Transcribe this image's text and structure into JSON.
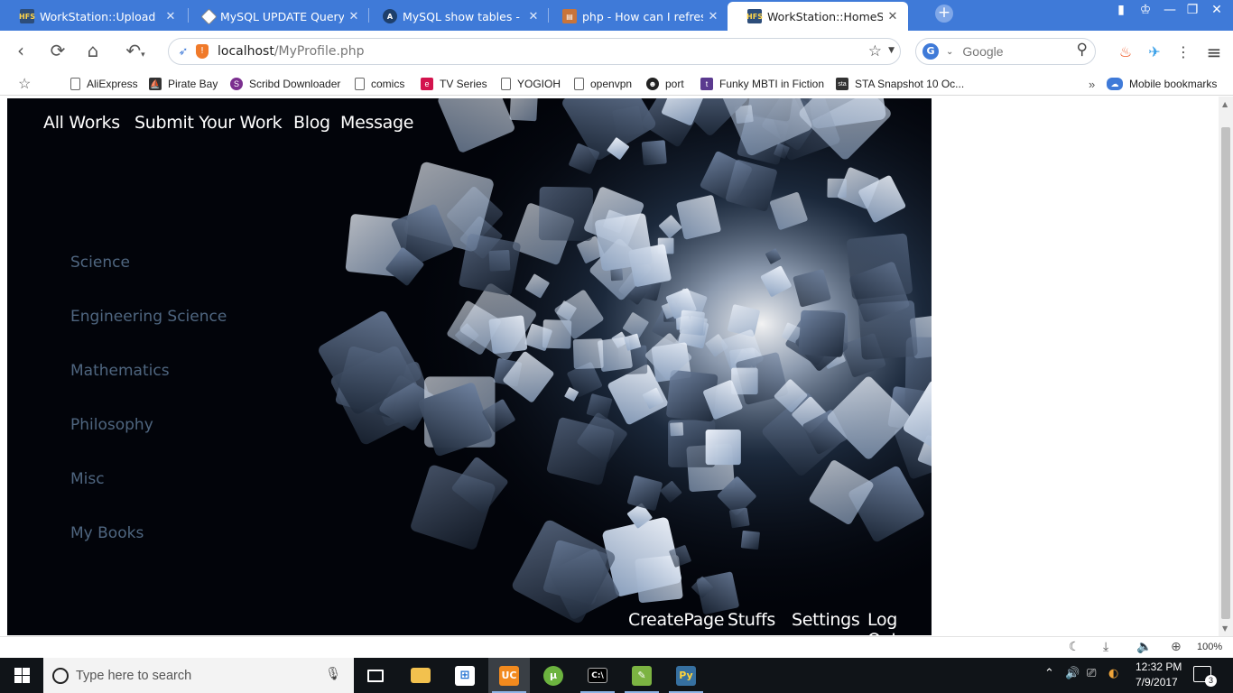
{
  "browser": {
    "tabs": [
      {
        "title": "WorkStation::Upload",
        "favicon": "hfs-icon",
        "active": false
      },
      {
        "title": "MySQL UPDATE Query",
        "favicon": "tutorialspoint-icon",
        "active": false
      },
      {
        "title": "MySQL show tables - How",
        "favicon": "a-letter-icon",
        "active": false
      },
      {
        "title": "php - How can I refresh a",
        "favicon": "stackoverflow-icon",
        "active": false
      },
      {
        "title": "WorkStation::HomeScreen",
        "favicon": "hfs-icon",
        "active": true
      }
    ],
    "address": {
      "host": "localhost",
      "path": "/MyProfile.php"
    },
    "search": {
      "placeholder": "Google"
    },
    "bookmarks": [
      {
        "label": "AliExpress",
        "icon": "page-icon"
      },
      {
        "label": "Pirate Bay",
        "icon": "pirate-ship-icon"
      },
      {
        "label": "Scribd Downloader",
        "icon": "scribd-icon"
      },
      {
        "label": "comics",
        "icon": "page-icon"
      },
      {
        "label": "TV Series",
        "icon": "e-letter-icon"
      },
      {
        "label": "YOGIOH",
        "icon": "page-icon"
      },
      {
        "label": "openvpn",
        "icon": "page-icon"
      },
      {
        "label": "port",
        "icon": "penguin-icon"
      },
      {
        "label": "Funky MBTI in Fiction",
        "icon": "tumblr-icon"
      },
      {
        "label": "STA Snapshot 10 Oc...",
        "icon": "sta-icon"
      }
    ],
    "mobile_bookmarks": "Mobile bookmarks",
    "zoom": "100%"
  },
  "page": {
    "top_nav": [
      "All Works",
      "Submit Your Work",
      "Blog",
      "Message"
    ],
    "categories": [
      "Science",
      "Engineering Science",
      "Mathematics",
      "Philosophy",
      "Misc",
      "My Books"
    ],
    "bottom_nav": [
      "CreatePage",
      "Stuffs",
      "Settings",
      "Log Out"
    ],
    "colors": {
      "background": "#02040a",
      "category_link": "#4f6680",
      "nav_link": "#ffffff"
    }
  },
  "taskbar": {
    "search_placeholder": "Type here to search",
    "apps": [
      "task-view-icon",
      "file-explorer-icon",
      "store-icon",
      "uc-browser-icon",
      "utorrent-icon",
      "terminal-icon",
      "editor-icon",
      "python-icon"
    ],
    "clock_time": "12:32 PM",
    "clock_date": "7/9/2017",
    "notifications": "3"
  }
}
